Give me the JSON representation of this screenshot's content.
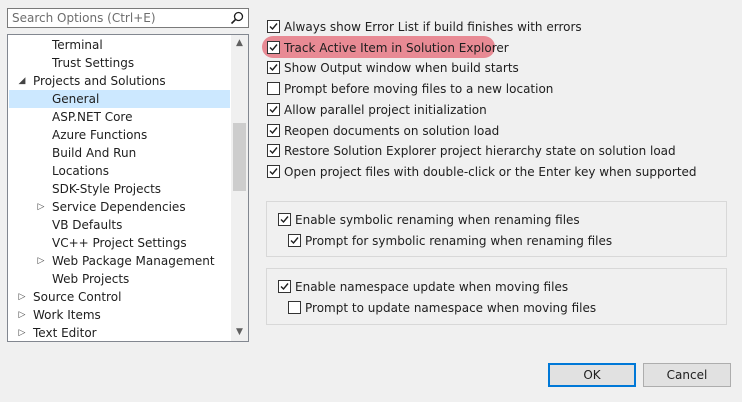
{
  "search": {
    "placeholder": "Search Options (Ctrl+E)",
    "icon": "search-icon"
  },
  "tree": {
    "items": [
      {
        "label": "Terminal",
        "level": 2,
        "expander": ""
      },
      {
        "label": "Trust Settings",
        "level": 2,
        "expander": ""
      },
      {
        "label": "Projects and Solutions",
        "level": 1,
        "expander": "expanded"
      },
      {
        "label": "General",
        "level": 2,
        "expander": "",
        "selected": true
      },
      {
        "label": "ASP.NET Core",
        "level": 2,
        "expander": ""
      },
      {
        "label": "Azure Functions",
        "level": 2,
        "expander": ""
      },
      {
        "label": "Build And Run",
        "level": 2,
        "expander": ""
      },
      {
        "label": "Locations",
        "level": 2,
        "expander": ""
      },
      {
        "label": "SDK-Style Projects",
        "level": 2,
        "expander": ""
      },
      {
        "label": "Service Dependencies",
        "level": 2,
        "expander": "collapsed"
      },
      {
        "label": "VB Defaults",
        "level": 2,
        "expander": ""
      },
      {
        "label": "VC++ Project Settings",
        "level": 2,
        "expander": ""
      },
      {
        "label": "Web Package Management",
        "level": 2,
        "expander": "collapsed"
      },
      {
        "label": "Web Projects",
        "level": 2,
        "expander": ""
      },
      {
        "label": "Source Control",
        "level": 1,
        "expander": "collapsed"
      },
      {
        "label": "Work Items",
        "level": 1,
        "expander": "collapsed"
      },
      {
        "label": "Text Editor",
        "level": 1,
        "expander": "collapsed"
      }
    ]
  },
  "options": [
    {
      "label": "Always show Error List if build finishes with errors",
      "checked": true
    },
    {
      "label": "Track Active Item in Solution Explorer",
      "checked": true,
      "highlighted": true
    },
    {
      "label": "Show Output window when build starts",
      "checked": true
    },
    {
      "label": "Prompt before moving files to a new location",
      "checked": false
    },
    {
      "label": "Allow parallel project initialization",
      "checked": true
    },
    {
      "label": "Reopen documents on solution load",
      "checked": true
    },
    {
      "label": "Restore Solution Explorer project hierarchy state on solution load",
      "checked": true
    },
    {
      "label": "Open project files with double-click or the Enter key when supported",
      "checked": true
    }
  ],
  "group1": [
    {
      "label": "Enable symbolic renaming when renaming files",
      "checked": true
    },
    {
      "label": "Prompt for symbolic renaming when renaming files",
      "checked": true
    }
  ],
  "group2": [
    {
      "label": "Enable namespace update when moving files",
      "checked": true
    },
    {
      "label": "Prompt to update namespace when moving files",
      "checked": false
    }
  ],
  "buttons": {
    "ok": "OK",
    "cancel": "Cancel"
  },
  "colors": {
    "selection": "#cce8ff",
    "highlight": "#e88a94",
    "primary_border": "#0078d7"
  }
}
